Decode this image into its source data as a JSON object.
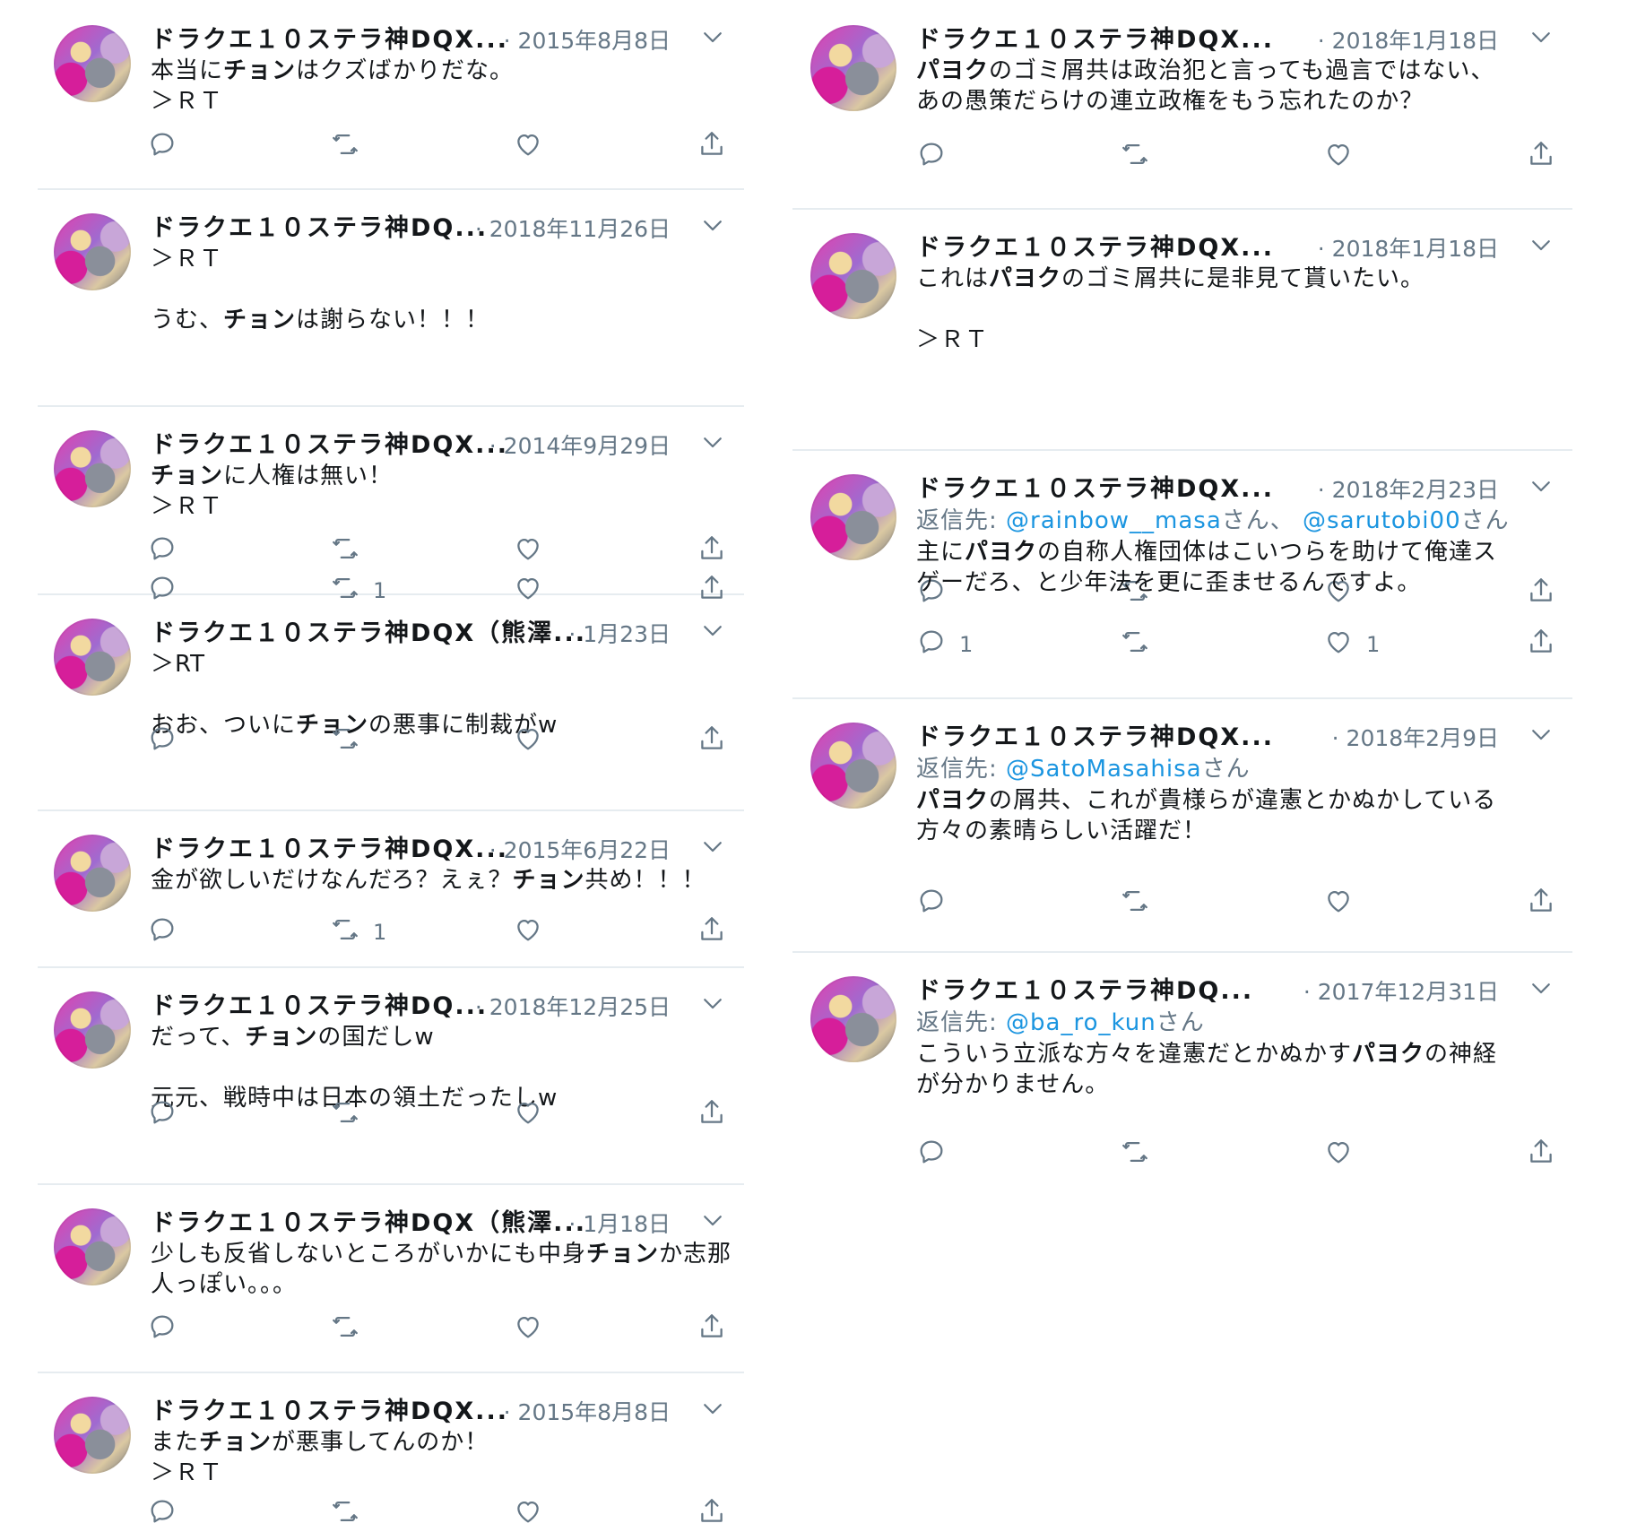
{
  "colors": {
    "text": "#14171a",
    "muted": "#657786",
    "link": "#1b95e0",
    "divider": "#e6ecf0"
  },
  "icons": {
    "reply": "reply-icon",
    "retweet": "retweet-icon",
    "like": "heart-icon",
    "share": "share-icon",
    "caret": "chevron-down-icon",
    "avatar": "user-avatar"
  },
  "left_column": [
    {
      "name": "ドラクエ１０ステラ神DQX...",
      "date": "· 2015年8月8日",
      "lines": [
        [
          [
            "本当に",
            0
          ],
          [
            "チョン",
            1
          ],
          [
            "はクズばかりだな。",
            0
          ]
        ],
        [
          [
            "＞ＲＴ",
            0
          ]
        ]
      ],
      "counts": {
        "reply": "",
        "retweet": "",
        "like": ""
      }
    },
    {
      "name": "ドラクエ１０ステラ神DQ...",
      "date": "· 2018年11月26日",
      "lines": [
        [
          [
            "＞ＲＴ",
            0
          ]
        ],
        [],
        [
          [
            "うむ、",
            0
          ],
          [
            "チョン",
            1
          ],
          [
            "は謝らない！！！",
            0
          ]
        ]
      ],
      "counts": {
        "reply": "",
        "retweet": "",
        "like": ""
      }
    },
    {
      "name": "ドラクエ１０ステラ神DQX...",
      "date": "· 2014年9月29日",
      "lines": [
        [
          [
            "チョン",
            1
          ],
          [
            "に人権は無い！",
            0
          ]
        ],
        [
          [
            "＞ＲＴ",
            0
          ]
        ]
      ],
      "counts": {
        "reply": "",
        "retweet": "1",
        "like": ""
      }
    },
    {
      "name": "ドラクエ１０ステラ神DQX（熊澤...",
      "date": "· 1月23日",
      "lines": [
        [
          [
            "＞RT",
            0
          ]
        ],
        [],
        [
          [
            "おお、ついに",
            0
          ],
          [
            "チョン",
            1
          ],
          [
            "の悪事に制裁がw",
            0
          ]
        ]
      ],
      "counts": {
        "reply": "",
        "retweet": "",
        "like": ""
      }
    },
    {
      "name": "ドラクエ１０ステラ神DQX...",
      "date": "· 2015年6月22日",
      "lines": [
        [
          [
            "金が欲しいだけなんだろ？えぇ？",
            0
          ],
          [
            "チョン",
            1
          ],
          [
            "共め！！！",
            0
          ]
        ]
      ],
      "counts": {
        "reply": "",
        "retweet": "1",
        "like": ""
      }
    },
    {
      "name": "ドラクエ１０ステラ神DQ...",
      "date": "· 2018年12月25日",
      "lines": [
        [
          [
            "だって、",
            0
          ],
          [
            "チョン",
            1
          ],
          [
            "の国だしw",
            0
          ]
        ],
        [],
        [
          [
            "元元、戦時中は日本の領土だったしw",
            0
          ]
        ]
      ],
      "counts": {
        "reply": "",
        "retweet": "",
        "like": ""
      }
    },
    {
      "name": "ドラクエ１０ステラ神DQX（熊澤...",
      "date": "· 1月18日",
      "lines": [
        [
          [
            "少しも反省しないところがいかにも中身",
            0
          ],
          [
            "チョン",
            1
          ],
          [
            "か志那",
            0
          ]
        ],
        [
          [
            "人っぽい。。。",
            0
          ]
        ]
      ],
      "counts": {
        "reply": "",
        "retweet": "",
        "like": ""
      }
    },
    {
      "name": "ドラクエ１０ステラ神DQX...",
      "date": "· 2015年8月8日",
      "lines": [
        [
          [
            "また",
            0
          ],
          [
            "チョン",
            1
          ],
          [
            "が悪事してんのか！",
            0
          ]
        ],
        [
          [
            "＞ＲＴ",
            0
          ]
        ]
      ],
      "counts": {
        "reply": "",
        "retweet": "",
        "like": ""
      }
    }
  ],
  "right_column": [
    {
      "name": "ドラクエ１０ステラ神DQX...",
      "date": "· 2018年1月18日",
      "lines": [
        [
          [
            "パヨク",
            1
          ],
          [
            "のゴミ屑共は政治犯と言っても過言ではない、",
            0
          ]
        ],
        [
          [
            "あの愚策だらけの連立政権をもう忘れたのか？",
            0
          ]
        ]
      ],
      "counts": {
        "reply": "",
        "retweet": "",
        "like": ""
      }
    },
    {
      "name": "ドラクエ１０ステラ神DQX...",
      "date": "· 2018年1月18日",
      "lines": [
        [
          [
            "これは",
            0
          ],
          [
            "パヨク",
            1
          ],
          [
            "のゴミ屑共に是非見て貰いたい。",
            0
          ]
        ],
        [],
        [
          [
            "＞ＲＴ",
            0
          ]
        ]
      ],
      "counts": {
        "reply": "",
        "retweet": "",
        "like": ""
      }
    },
    {
      "name": "ドラクエ１０ステラ神DQX...",
      "date": "· 2018年2月23日",
      "reply_to": {
        "label": "返信先: ",
        "mentions": [
          "@rainbow__masa",
          "@sarutobi00"
        ],
        "suffix": "さん",
        "sep": "さん、 "
      },
      "lines": [
        [
          [
            "主に",
            0
          ],
          [
            "パヨク",
            1
          ],
          [
            "の自称人権団体はこいつらを助けて俺達ス",
            0
          ]
        ],
        [
          [
            "ゲーだろ、と少年法を更に歪ませるんですよ。",
            0
          ]
        ]
      ],
      "counts": {
        "reply": "1",
        "retweet": "",
        "like": "1"
      }
    },
    {
      "name": "ドラクエ１０ステラ神DQX...",
      "date": "· 2018年2月9日",
      "reply_to": {
        "label": "返信先: ",
        "mentions": [
          "@SatoMasahisa"
        ],
        "suffix": "さん",
        "sep": ""
      },
      "lines": [
        [
          [
            "パヨク",
            1
          ],
          [
            "の屑共、これが貴様らが違憲とかぬかしている",
            0
          ]
        ],
        [
          [
            "方々の素晴らしい活躍だ！",
            0
          ]
        ]
      ],
      "counts": {
        "reply": "",
        "retweet": "",
        "like": ""
      }
    },
    {
      "name": "ドラクエ１０ステラ神DQ...",
      "date": "· 2017年12月31日",
      "reply_to": {
        "label": "返信先: ",
        "mentions": [
          "@ba_ro_kun"
        ],
        "suffix": "さん",
        "sep": ""
      },
      "lines": [
        [
          [
            "こういう立派な方々を違憲だとかぬかす",
            0
          ],
          [
            "パヨク",
            1
          ],
          [
            "の神経",
            0
          ]
        ],
        [
          [
            "が分かりません。",
            0
          ]
        ]
      ],
      "counts": {
        "reply": "",
        "retweet": "",
        "like": ""
      }
    }
  ]
}
